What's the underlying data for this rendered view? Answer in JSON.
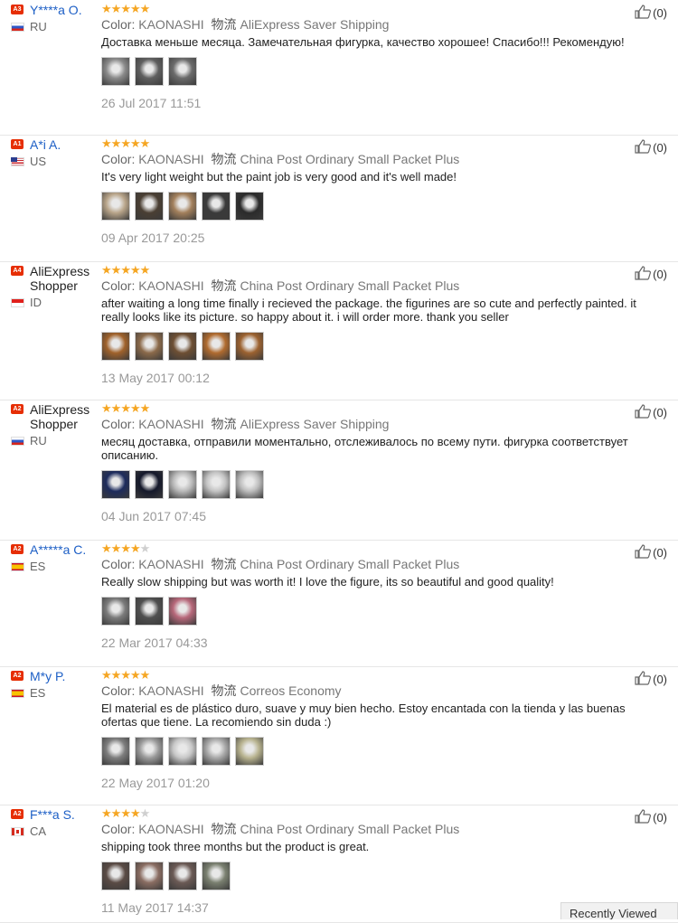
{
  "meta_labels": {
    "color": "Color:",
    "logistics": "物流"
  },
  "reviews": [
    {
      "level": "A3",
      "name": "Y****a O.",
      "name_color": "link",
      "country": "RU",
      "flag": "ru",
      "stars": 5,
      "color": "KAONASHI",
      "shipping": "AliExpress Saver Shipping",
      "text": "Доставка меньше месяца. Замечательная фигурка, качество хорошее! Спасибо!!! Рекомендую!",
      "photos": [
        "#8a8a8a",
        "#5f5f5f",
        "#6b6b6b"
      ],
      "date": "26 Jul 2017 11:51",
      "helpful": "(0)"
    },
    {
      "level": "A1",
      "name": "A*i A.",
      "name_color": "link",
      "country": "US",
      "flag": "us",
      "stars": 5,
      "color": "KAONASHI",
      "shipping": "China Post Ordinary Small Packet Plus",
      "text": "It's very light weight but the paint job is very good and it's well made!",
      "photos": [
        "#b9a58a",
        "#4a3f33",
        "#a3805c",
        "#3a3a3a",
        "#2b2b2b"
      ],
      "date": "09 Apr 2017 20:25",
      "helpful": "(0)"
    },
    {
      "level": "A4",
      "name": "AliExpress Shopper",
      "name_color": "dark",
      "country": "ID",
      "flag": "id",
      "stars": 5,
      "color": "KAONASHI",
      "shipping": "China Post Ordinary Small Packet Plus",
      "text": "after waiting a long time finally i recieved the package. the figurines are so cute and perfectly painted. it really looks like its picture. so happy about it. i will order more. thank you seller",
      "photos": [
        "#a0622b",
        "#8b6a4a",
        "#6e4f33",
        "#b06b2f",
        "#9c6230"
      ],
      "date": "13 May 2017 00:12",
      "helpful": "(0)"
    },
    {
      "level": "A2",
      "name": "AliExpress Shopper",
      "name_color": "dark",
      "country": "RU",
      "flag": "ru",
      "stars": 5,
      "color": "KAONASHI",
      "shipping": "AliExpress Saver Shipping",
      "text": "месяц доставка, отправили моментально, отслеживалось по всему пути. фигурка соответствует описанию.",
      "photos": [
        "#1d2b5c",
        "#14182a",
        "#b9b9b9",
        "#c3c3c3",
        "#bdbdbd"
      ],
      "date": "04 Jun 2017 07:45",
      "helpful": "(0)"
    },
    {
      "level": "A2",
      "name": "A*****a C.",
      "name_color": "link",
      "country": "ES",
      "flag": "es",
      "stars": 4,
      "color": "KAONASHI",
      "shipping": "China Post Ordinary Small Packet Plus",
      "text": "Really slow shipping but was worth it! I love the figure, its so beautiful and good quality!",
      "photos": [
        "#7b7b7b",
        "#4f4f4f",
        "#b7687a"
      ],
      "date": "22 Mar 2017 04:33",
      "helpful": "(0)"
    },
    {
      "level": "A2",
      "name": "M*y P.",
      "name_color": "link",
      "country": "ES",
      "flag": "es",
      "stars": 5,
      "color": "KAONASHI",
      "shipping": "Correos Economy",
      "text": "El material es de plástico duro, suave y muy bien hecho. Estoy encantada con la tienda y las buenas ofertas que tiene. La recomiendo sin duda :)",
      "photos": [
        "#7d7d7d",
        "#9a9a9a",
        "#c7c7c7",
        "#a8a8a8",
        "#b8b38f"
      ],
      "date": "22 May 2017 01:20",
      "helpful": "(0)"
    },
    {
      "level": "A2",
      "name": "F***a S.",
      "name_color": "link",
      "country": "CA",
      "flag": "ca",
      "stars": 4,
      "color": "KAONASHI",
      "shipping": "China Post Ordinary Small Packet Plus",
      "text": "shipping took three months but the product is great.",
      "photos": [
        "#5a4b45",
        "#8a6d62",
        "#6b5a55",
        "#7a8070"
      ],
      "date": "11 May 2017 14:37",
      "helpful": "(0)"
    }
  ],
  "recently_viewed": "Recently Viewed"
}
